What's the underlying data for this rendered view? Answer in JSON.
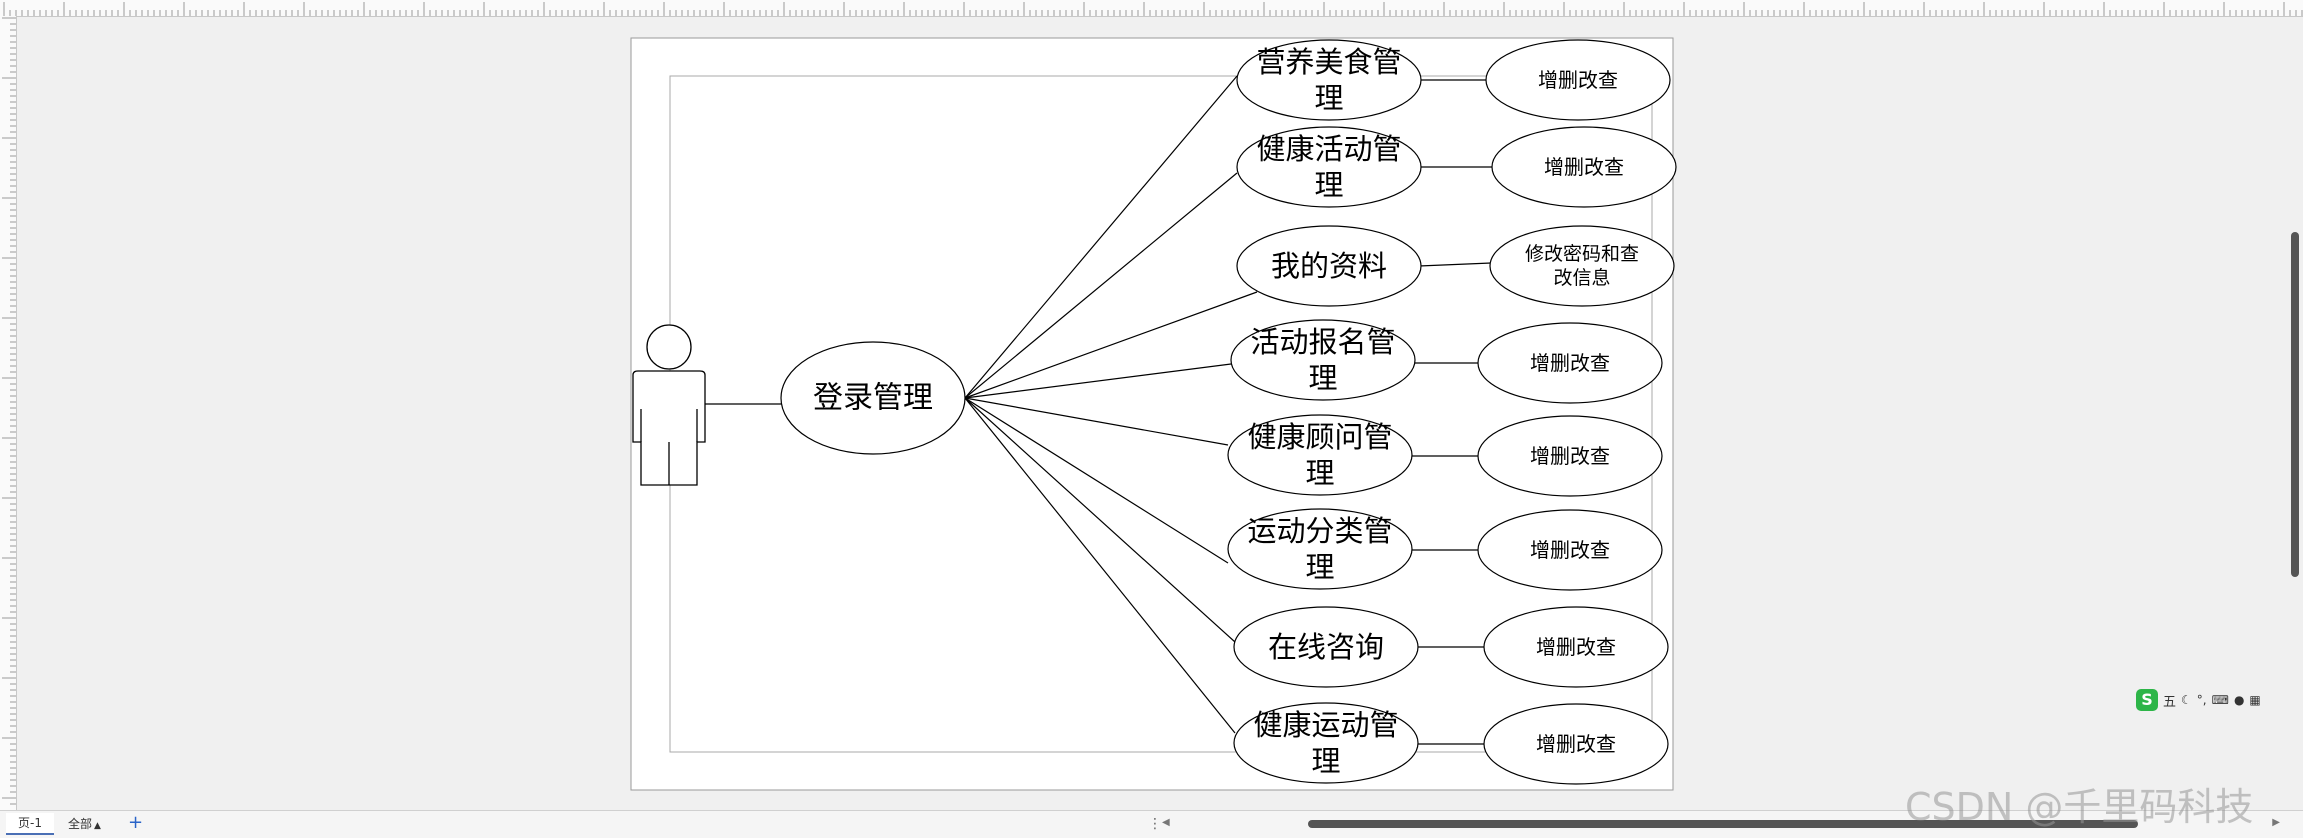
{
  "diagram": {
    "actor_label": "",
    "login": "登录管理",
    "modules": [
      {
        "lines": [
          "营养美食管",
          "理"
        ],
        "action_lines": [
          "增删改查"
        ]
      },
      {
        "lines": [
          "健康活动管",
          "理"
        ],
        "action_lines": [
          "增删改查"
        ]
      },
      {
        "lines": [
          "我的资料"
        ],
        "action_lines": [
          "修改密码和查",
          "改信息"
        ]
      },
      {
        "lines": [
          "活动报名管",
          "理"
        ],
        "action_lines": [
          "增删改查"
        ]
      },
      {
        "lines": [
          "健康顾问管",
          "理"
        ],
        "action_lines": [
          "增删改查"
        ]
      },
      {
        "lines": [
          "运动分类管",
          "理"
        ],
        "action_lines": [
          "增删改查"
        ]
      },
      {
        "lines": [
          "在线咨询"
        ],
        "action_lines": [
          "增删改查"
        ]
      },
      {
        "lines": [
          "健康运动管",
          "理"
        ],
        "action_lines": [
          "增删改查"
        ]
      }
    ]
  },
  "bottom_bar": {
    "page_tab": "页-1",
    "all_tab": "全部",
    "add_icon": "plus-icon",
    "more_icon": "vertical-dots-icon"
  },
  "ime_toolbar": {
    "logo": "S",
    "mode": "五",
    "icons": [
      "moon-icon",
      "punctuation-icon",
      "keyboard-icon",
      "user-icon",
      "grid-icon"
    ]
  },
  "watermark": "CSDN @千里码科技"
}
